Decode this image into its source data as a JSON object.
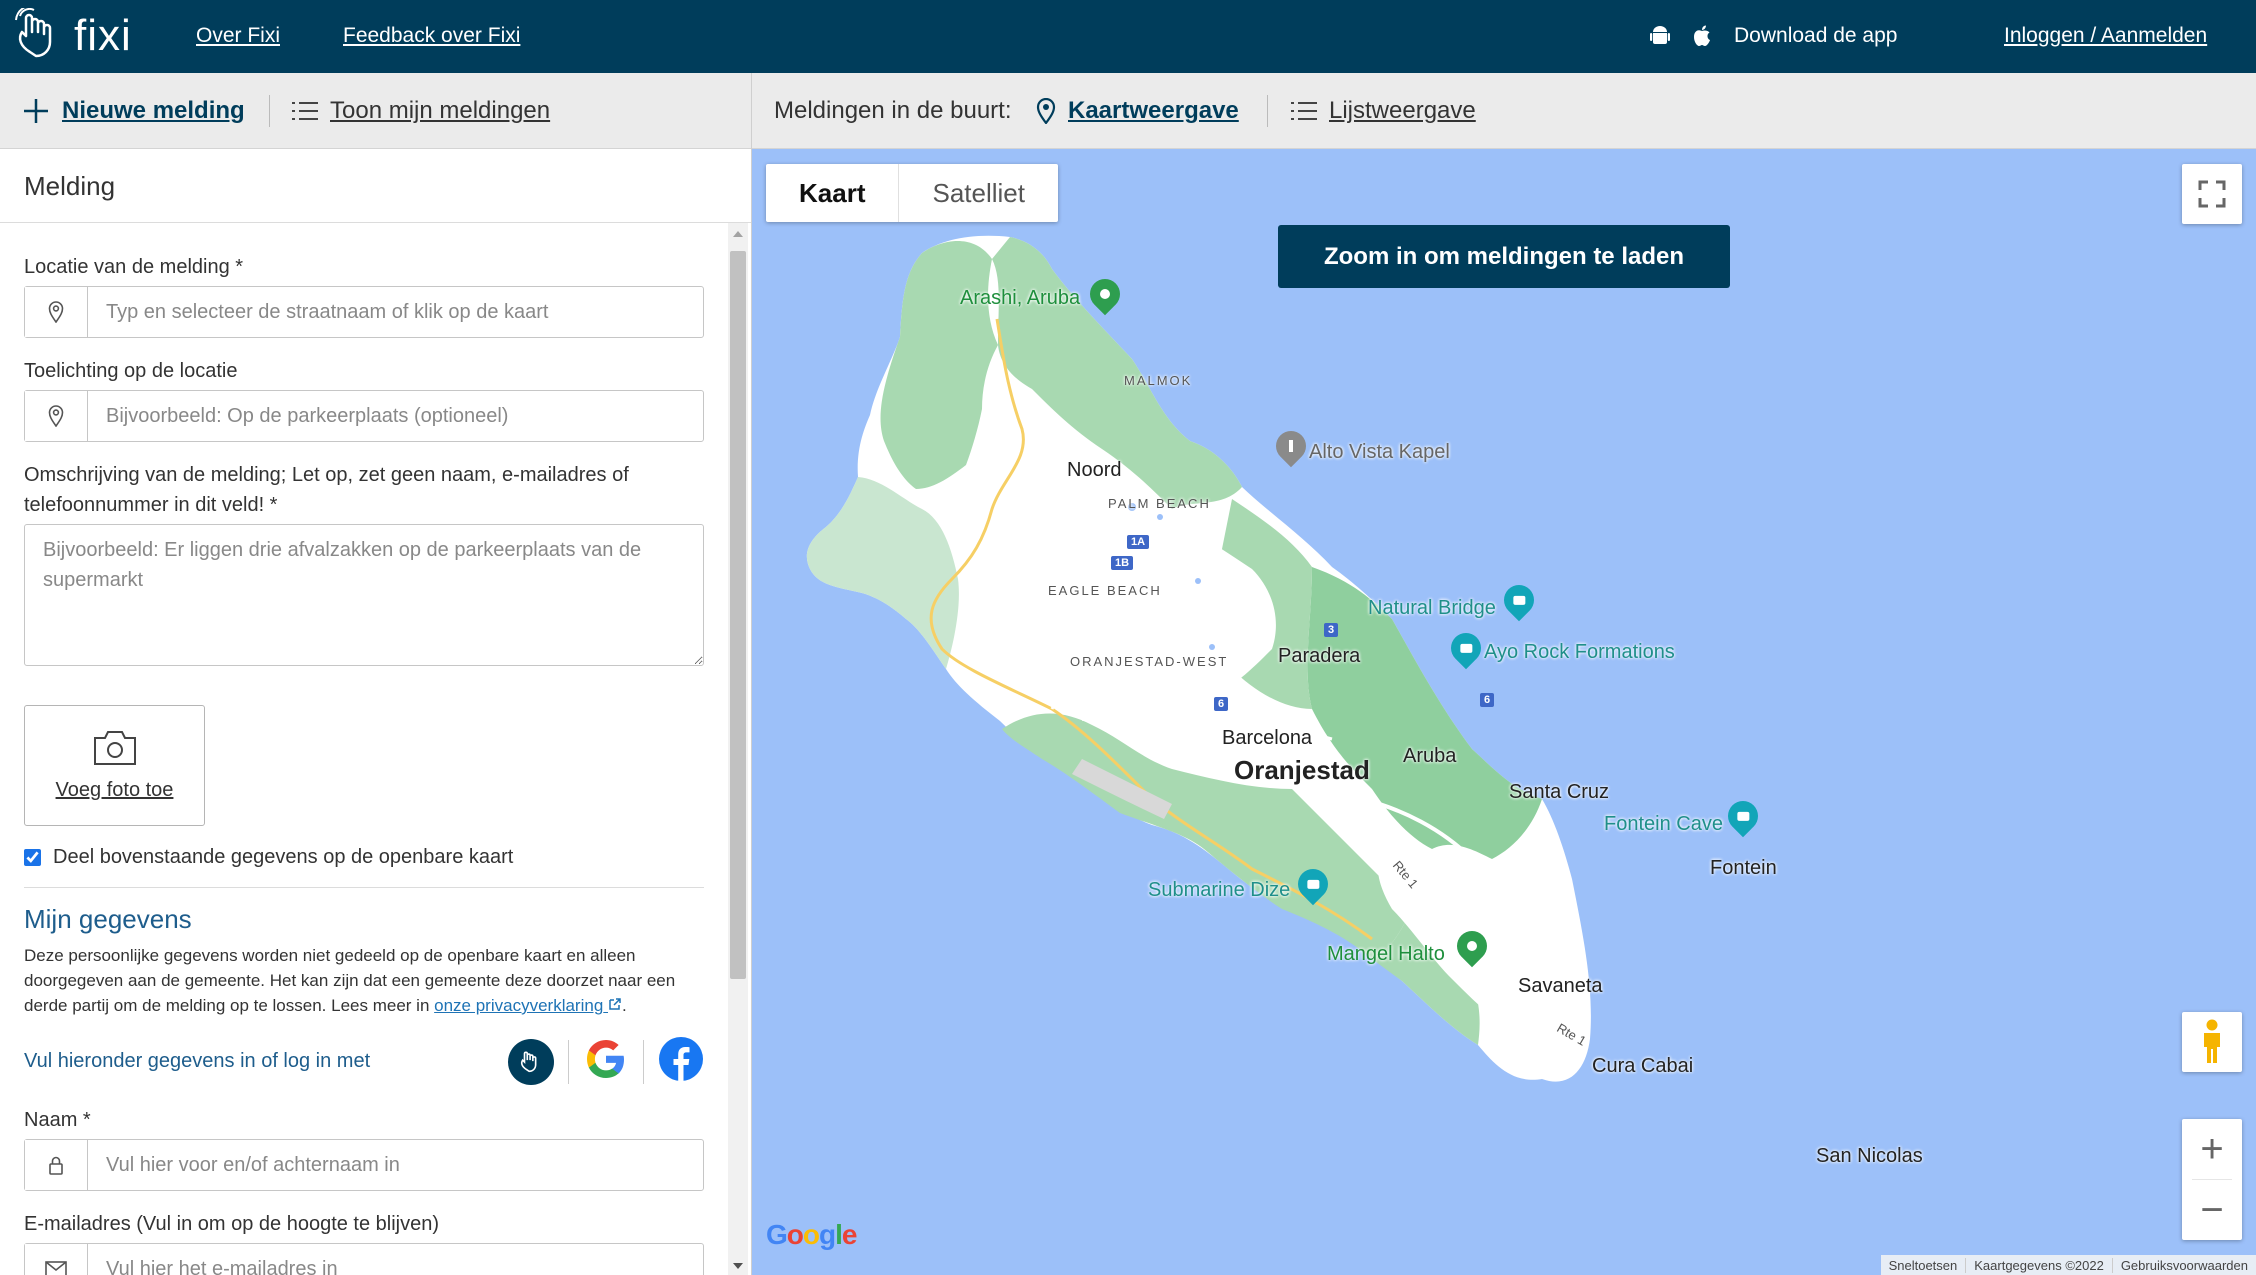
{
  "header": {
    "logo_text": "fixi",
    "links": [
      "Over Fixi",
      "Feedback over Fixi"
    ],
    "download_label": "Download de app",
    "login_label": "Inloggen / Aanmelden"
  },
  "subheader": {
    "new_report": "Nieuwe melding",
    "my_reports": "Toon mijn meldingen",
    "nearby_label": "Meldingen in de buurt:",
    "map_view": "Kaartweergave",
    "list_view": "Lijstweergave"
  },
  "form": {
    "title": "Melding",
    "location_label": "Locatie van de melding *",
    "location_placeholder": "Typ en selecteer de straatnaam of klik op de kaart",
    "location_note_label": "Toelichting op de locatie",
    "location_note_placeholder": "Bijvoorbeeld: Op de parkeerplaats (optioneel)",
    "description_label": "Omschrijving van de melding; Let op, zet geen naam, e-mailadres of telefoonnummer in dit veld! *",
    "description_placeholder": "Bijvoorbeeld: Er liggen drie afvalzakken op de parkeerplaats van de supermarkt",
    "photo_label": "Voeg foto toe",
    "share_label": "Deel bovenstaande gegevens op de openbare kaart",
    "share_checked": true
  },
  "personal": {
    "title": "Mijn gegevens",
    "text": "Deze persoonlijke gegevens worden niet gedeeld op de openbare kaart en alleen doorgegeven aan de gemeente. Het kan zijn dat een gemeente deze doorzet naar een derde partij om de melding op te lossen. Lees meer in",
    "privacy_link": "onze privacyverklaring",
    "text_end": ".",
    "login_with": "Vul hieronder gegevens in of log in met",
    "name_label": "Naam *",
    "name_placeholder": "Vul hier voor en/of achternaam in",
    "email_label": "E-mailadres (Vul in om op de hoogte te blijven)",
    "email_placeholder": "Vul hier het e-mailadres in"
  },
  "map": {
    "type_map": "Kaart",
    "type_satellite": "Satelliet",
    "zoom_banner": "Zoom in om meldingen te laden",
    "towns": [
      "Noord",
      "Paradera",
      "Barcelona",
      "Aruba",
      "Santa Cruz",
      "Fontein",
      "Savaneta",
      "Cura Cabai",
      "San Nicolas"
    ],
    "capital": "Oranjestad",
    "areas": [
      "MALMOK",
      "PALM BEACH",
      "EAGLE BEACH",
      "ORANJESTAD-WEST"
    ],
    "pois": [
      "Arashi, Aruba",
      "Alto Vista Kapel",
      "Natural Bridge",
      "Ayo Rock Formations",
      "Fontein Cave",
      "Submarine Dize",
      "Mangel Halto"
    ],
    "routes": [
      "1A",
      "1B",
      "3",
      "6",
      "6"
    ],
    "road_labels": [
      "Rte 1",
      "Rte 1"
    ],
    "google": "Google",
    "attribution": [
      "Sneltoetsen",
      "Kaartgegevens ©2022",
      "Gebruiksvoorwaarden"
    ],
    "zoom_in": "+",
    "zoom_out": "−"
  },
  "colors": {
    "brand": "#003d5b",
    "water": "#9cc0f9",
    "land": "#ffffff",
    "park": "#a8d9b1",
    "link": "#1e73b5"
  }
}
